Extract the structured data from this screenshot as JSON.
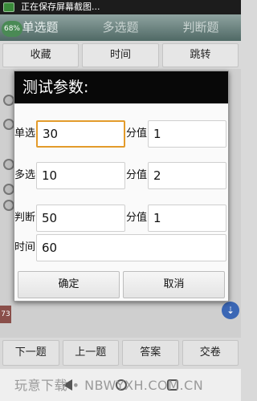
{
  "status_bar": {
    "text": "正在保存屏幕截图..."
  },
  "battery": "68%",
  "type_tabs": [
    "单选题",
    "多选题",
    "判断题"
  ],
  "toolbar": {
    "favorite": "收藏",
    "time": "时间",
    "jump": "跳转"
  },
  "side_tab": "73",
  "dialog": {
    "title": "测试参数:",
    "rows": [
      {
        "label": "单选",
        "value": "30",
        "score_label": "分值",
        "score": "1"
      },
      {
        "label": "多选",
        "value": "10",
        "score_label": "分值",
        "score": "2"
      },
      {
        "label": "判断",
        "value": "50",
        "score_label": "分值",
        "score": "1"
      }
    ],
    "time_label": "时间",
    "time_value": "60",
    "ok_label": "确定",
    "cancel_label": "取消"
  },
  "bottom_buttons": {
    "prev": "下一题",
    "next": "上一题",
    "answer": "答案",
    "submit": "交卷"
  },
  "watermark": "玩意下载 • NBWYXH.COM.CN",
  "icons": {
    "fab": "download-icon",
    "nav_back": "back-icon",
    "nav_home": "home-icon",
    "nav_recent": "recent-apps-icon"
  }
}
